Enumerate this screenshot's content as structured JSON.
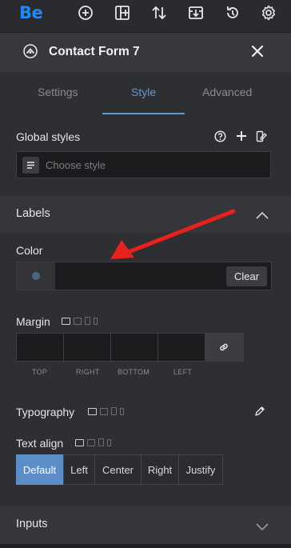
{
  "topbar": {
    "logo": "Be",
    "icons": [
      "add-circle-icon",
      "add-section-icon",
      "sort-icon",
      "import-icon",
      "history-icon",
      "settings-icon"
    ]
  },
  "panel": {
    "title": "Contact Form 7",
    "close_icon": "close-icon"
  },
  "tabs": [
    {
      "label": "Settings",
      "active": false
    },
    {
      "label": "Style",
      "active": true
    },
    {
      "label": "Advanced",
      "active": false
    }
  ],
  "global_styles": {
    "label": "Global styles",
    "placeholder": "Choose style"
  },
  "labels_section": {
    "title": "Labels",
    "color": {
      "label": "Color",
      "clear_label": "Clear"
    },
    "margin": {
      "label": "Margin",
      "fields": [
        "TOP",
        "RIGHT",
        "BOTTOM",
        "LEFT"
      ]
    },
    "typography": {
      "label": "Typography"
    },
    "text_align": {
      "label": "Text align",
      "options": [
        "Default",
        "Left",
        "Center",
        "Right",
        "Justify"
      ],
      "selected": "Default"
    }
  },
  "inputs_section": {
    "title": "Inputs"
  },
  "colors": {
    "accent": "#5b9bd5",
    "button_active": "#5b8dc9",
    "arrow": "#e8211c",
    "logo": "#1a8cff"
  }
}
